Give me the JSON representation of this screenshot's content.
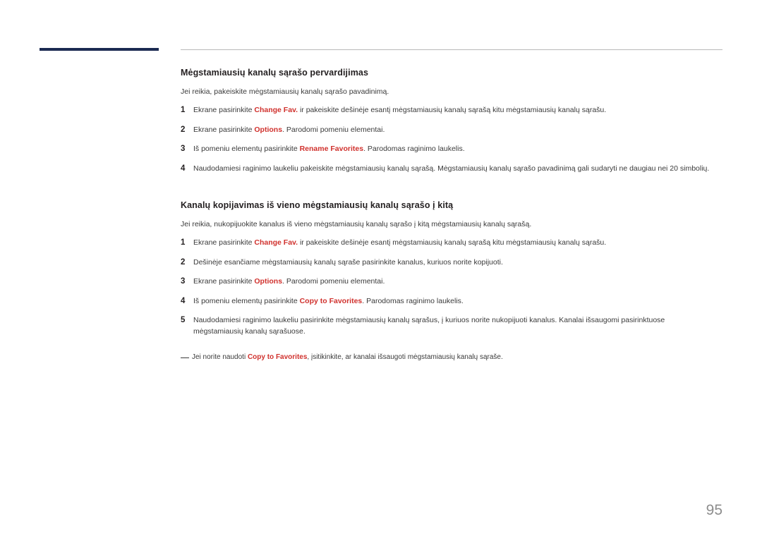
{
  "document": {
    "page_number": "95",
    "accent_color": "#1b2a52",
    "highlight_color": "#d0312d",
    "sections": [
      {
        "title": "Mėgstamiausių kanalų sąrašo pervardijimas",
        "intro": "Jei reikia, pakeiskite mėgstamiausių kanalų sąrašo pavadinimą.",
        "steps": [
          {
            "number": "1",
            "parts": [
              {
                "text": "Ekrane pasirinkite ",
                "style": "normal"
              },
              {
                "text": "Change Fav.",
                "style": "highlight"
              },
              {
                "text": " ir pakeiskite dešinėje esantį mėgstamiausių kanalų sąrašą kitu mėgstamiausių kanalų sąrašu.",
                "style": "normal"
              }
            ]
          },
          {
            "number": "2",
            "parts": [
              {
                "text": "Ekrane pasirinkite ",
                "style": "normal"
              },
              {
                "text": "Options",
                "style": "highlight"
              },
              {
                "text": ". Parodomi pomeniu elementai.",
                "style": "normal"
              }
            ]
          },
          {
            "number": "3",
            "parts": [
              {
                "text": "Iš pomeniu elementų pasirinkite ",
                "style": "normal"
              },
              {
                "text": "Rename Favorites",
                "style": "highlight"
              },
              {
                "text": ". Parodomas raginimo laukelis.",
                "style": "normal"
              }
            ]
          },
          {
            "number": "4",
            "parts": [
              {
                "text": "Naudodamiesi raginimo laukeliu pakeiskite mėgstamiausių kanalų sąrašą. Mėgstamiausių kanalų sąrašo pavadinimą gali sudaryti ne daugiau nei 20 simbolių.",
                "style": "normal"
              }
            ]
          }
        ]
      },
      {
        "title": "Kanalų kopijavimas iš vieno mėgstamiausių kanalų sąrašo į kitą",
        "intro": "Jei reikia, nukopijuokite kanalus iš vieno mėgstamiausių kanalų sąrašo į kitą mėgstamiausių kanalų sąrašą.",
        "steps": [
          {
            "number": "1",
            "parts": [
              {
                "text": "Ekrane pasirinkite ",
                "style": "normal"
              },
              {
                "text": "Change Fav.",
                "style": "highlight"
              },
              {
                "text": " ir pakeiskite dešinėje esantį mėgstamiausių kanalų sąrašą kitu mėgstamiausių kanalų sąrašu.",
                "style": "normal"
              }
            ]
          },
          {
            "number": "2",
            "parts": [
              {
                "text": "Dešinėje esančiame mėgstamiausių kanalų sąraše pasirinkite kanalus, kuriuos norite kopijuoti.",
                "style": "normal"
              }
            ]
          },
          {
            "number": "3",
            "parts": [
              {
                "text": "Ekrane pasirinkite ",
                "style": "normal"
              },
              {
                "text": "Options",
                "style": "highlight"
              },
              {
                "text": ". Parodomi pomeniu elementai.",
                "style": "normal"
              }
            ]
          },
          {
            "number": "4",
            "parts": [
              {
                "text": "Iš pomeniu elementų pasirinkite ",
                "style": "normal"
              },
              {
                "text": "Copy to Favorites",
                "style": "highlight"
              },
              {
                "text": ". Parodomas raginimo laukelis.",
                "style": "normal"
              }
            ]
          },
          {
            "number": "5",
            "parts": [
              {
                "text": "Naudodamiesi raginimo laukeliu pasirinkite mėgstamiausių kanalų sąrašus, į kuriuos norite nukopijuoti kanalus. Kanalai išsaugomi pasirinktuose mėgstamiausių kanalų sąrašuose.",
                "style": "normal"
              }
            ]
          }
        ],
        "note": {
          "parts": [
            {
              "text": "Jei norite naudoti ",
              "style": "normal"
            },
            {
              "text": "Copy to Favorites",
              "style": "highlight"
            },
            {
              "text": ", įsitikinkite, ar kanalai išsaugoti mėgstamiausių kanalų sąraše.",
              "style": "normal"
            }
          ]
        }
      }
    ]
  }
}
